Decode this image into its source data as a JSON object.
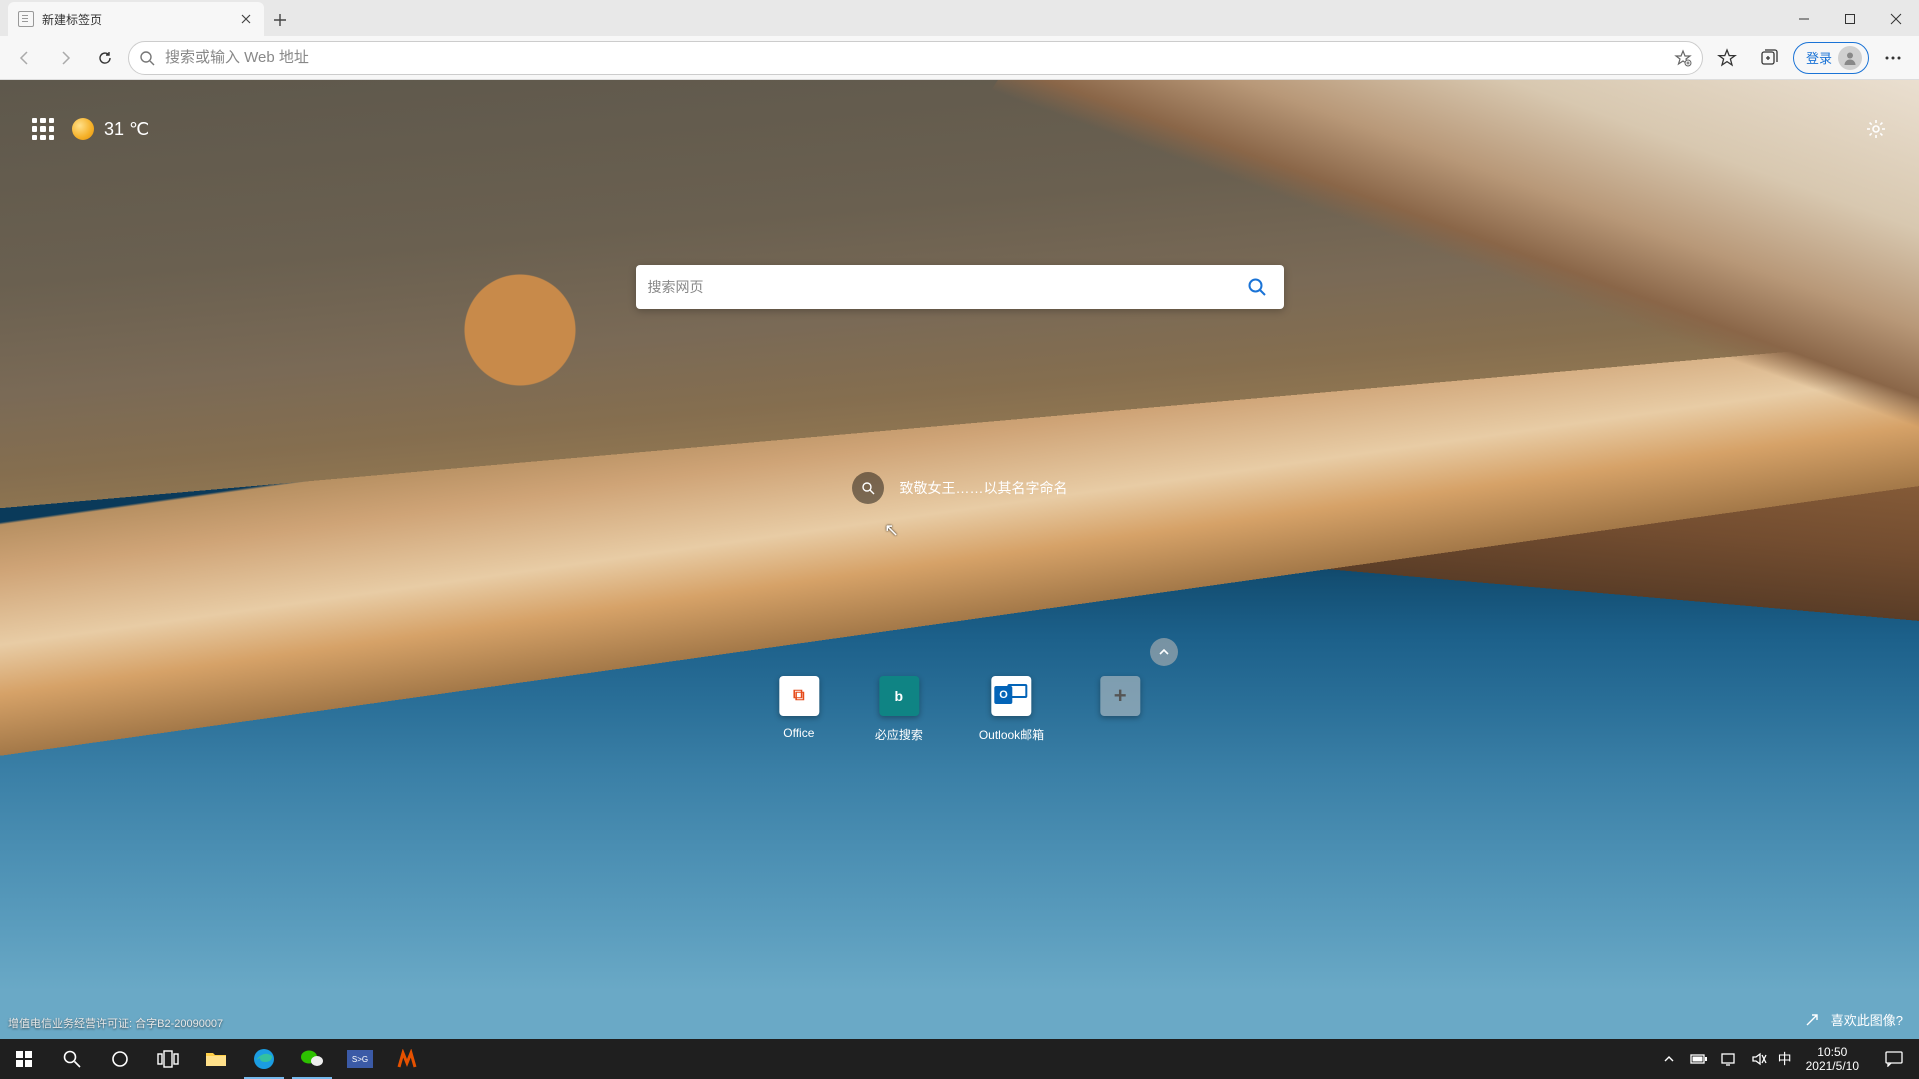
{
  "tab": {
    "title": "新建标签页"
  },
  "toolbar": {
    "omnibox_placeholder": "搜索或输入 Web 地址",
    "login_label": "登录"
  },
  "ntp": {
    "temperature": "31 ℃",
    "search_placeholder": "搜索网页",
    "hint_text": "致敬女王……以其名字命名",
    "tiles": [
      {
        "label": "Office"
      },
      {
        "label": "必应搜索"
      },
      {
        "label": "Outlook邮箱"
      }
    ],
    "footer_license": "增值电信业务经营许可证: 合字B2-20090007",
    "like_image": "喜欢此图像?"
  },
  "taskbar": {
    "ime": "中",
    "time": "10:50",
    "date": "2021/5/10"
  }
}
